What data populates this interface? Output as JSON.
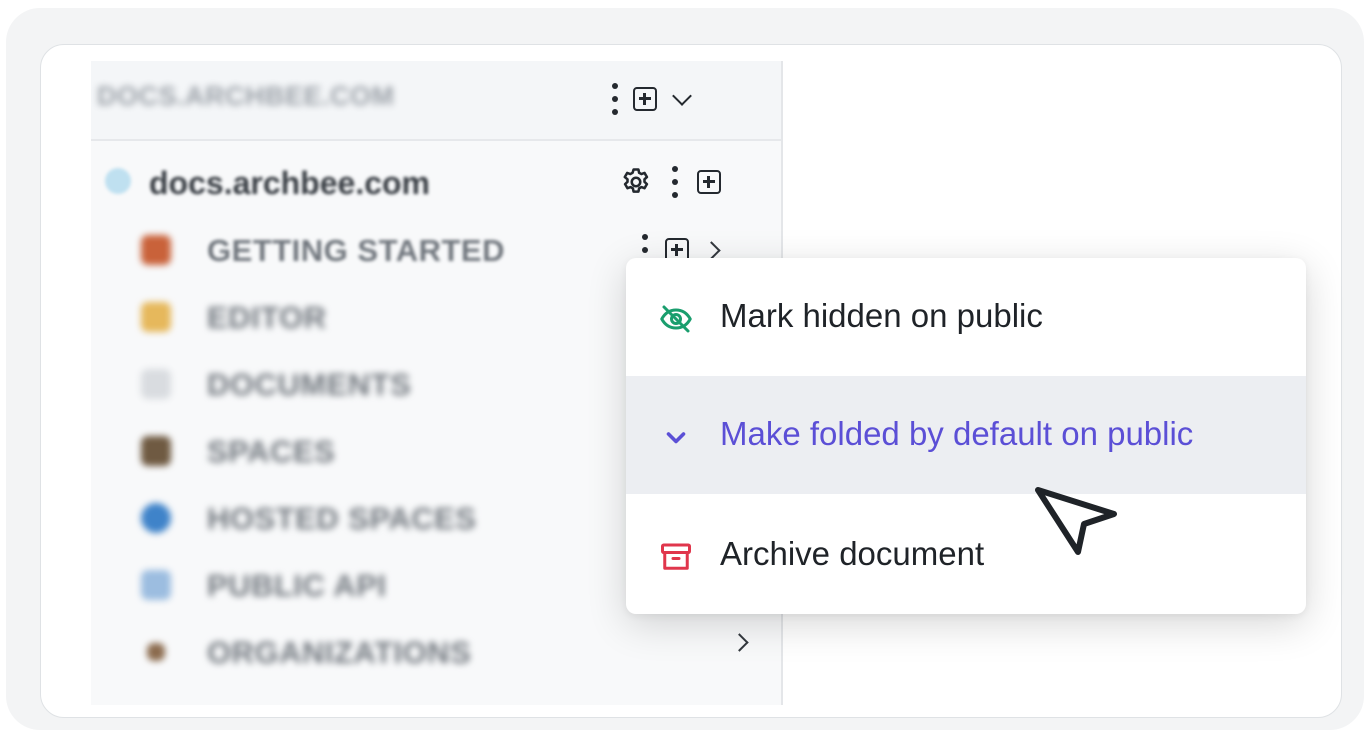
{
  "sidebar": {
    "site_name": "DOCS.ARCHBEE.COM",
    "root": {
      "label": "docs.archbee.com"
    },
    "items": [
      {
        "label": "GETTING STARTED",
        "icon": "rocket-icon",
        "color": "#c9623a"
      },
      {
        "label": "EDITOR",
        "icon": "pencil-icon",
        "color": "#e6b85c"
      },
      {
        "label": "DOCUMENTS",
        "icon": "document-icon",
        "color": "#d9dce0"
      },
      {
        "label": "SPACES",
        "icon": "folder-icon",
        "color": "#6f5a42"
      },
      {
        "label": "HOSTED SPACES",
        "icon": "globe-icon",
        "color": "#3f83c9"
      },
      {
        "label": "PUBLIC API",
        "icon": "api-icon",
        "color": "#9cbde0"
      },
      {
        "label": "ORGANIZATIONS",
        "icon": "organization-icon",
        "color": "#8b6b4e"
      }
    ]
  },
  "context_menu": {
    "items": [
      {
        "label": "Mark hidden on public",
        "icon": "eye-off-icon",
        "color": "#1a9e6e"
      },
      {
        "label": "Make folded by default on public",
        "icon": "chevron-down-icon",
        "color": "#5b4fd6",
        "highlighted": true
      },
      {
        "label": "Archive document",
        "icon": "archive-icon",
        "color": "#e0364c"
      }
    ]
  }
}
